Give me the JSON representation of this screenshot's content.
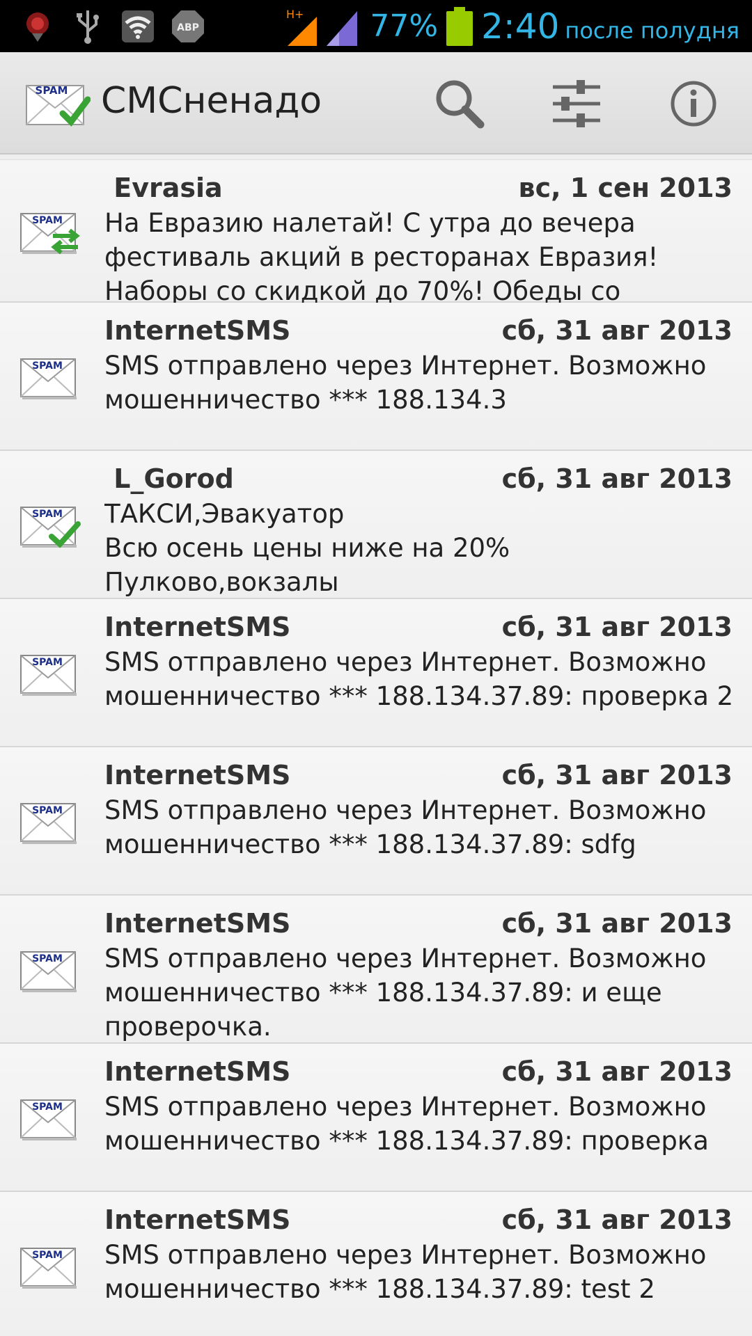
{
  "status_bar": {
    "icons": [
      "bug-icon",
      "usb-icon",
      "wifi-icon",
      "adblock-icon"
    ],
    "adblock_label": "ABP",
    "network_label": "H+",
    "battery_percent": "77%",
    "time": "2:40",
    "ampm": "после полудня",
    "colors": {
      "accent": "#33b5e5",
      "battery": "#99cc00",
      "network": "#ff8800"
    }
  },
  "action_bar": {
    "title": "СМСненадо",
    "logo_label": "SPAM",
    "buttons": [
      "search-icon",
      "settings-sliders-icon",
      "info-icon"
    ]
  },
  "messages": [
    {
      "sender": " Evrasia",
      "date": "вс, 1 сен 2013",
      "icon": "spam-forward-icon",
      "badge": "SPAM",
      "body": "На Евразию налетай! С утра до вечера фестиваль акций в ресторанах Евразия! Наборы со скидкой до 70%! Обеды со"
    },
    {
      "sender": "InternetSMS",
      "date": "сб, 31 авг 2013",
      "icon": "spam-icon",
      "badge": "SPAM",
      "body": "SMS отправлено через Интернет. Возможно мошенничество *** 188.134.3"
    },
    {
      "sender": " L_Gorod",
      "date": "сб, 31 авг 2013",
      "icon": "spam-check-icon",
      "badge": "SPAM",
      "body": "ТАКСИ,Эвакуатор\nВсю осень цены ниже на 20%\nПулково,вокзалы"
    },
    {
      "sender": "InternetSMS",
      "date": "сб, 31 авг 2013",
      "icon": "spam-icon",
      "badge": "SPAM",
      "body": "SMS отправлено через Интернет. Возможно мошенничество *** 188.134.37.89: проверка 2"
    },
    {
      "sender": "InternetSMS",
      "date": "сб, 31 авг 2013",
      "icon": "spam-icon",
      "badge": "SPAM",
      "body": "SMS отправлено через Интернет. Возможно мошенничество *** 188.134.37.89: sdfg"
    },
    {
      "sender": "InternetSMS",
      "date": "сб, 31 авг 2013",
      "icon": "spam-icon",
      "badge": "SPAM",
      "body": "SMS отправлено через Интернет. Возможно мошенничество *** 188.134.37.89: и еще проверочка."
    },
    {
      "sender": "InternetSMS",
      "date": "сб, 31 авг 2013",
      "icon": "spam-icon",
      "badge": "SPAM",
      "body": "SMS отправлено через Интернет. Возможно мошенничество *** 188.134.37.89: проверка"
    },
    {
      "sender": "InternetSMS",
      "date": "сб, 31 авг 2013",
      "icon": "spam-icon",
      "badge": "SPAM",
      "body": "SMS отправлено через Интернет. Возможно мошенничество *** 188.134.37.89: test 2"
    }
  ]
}
